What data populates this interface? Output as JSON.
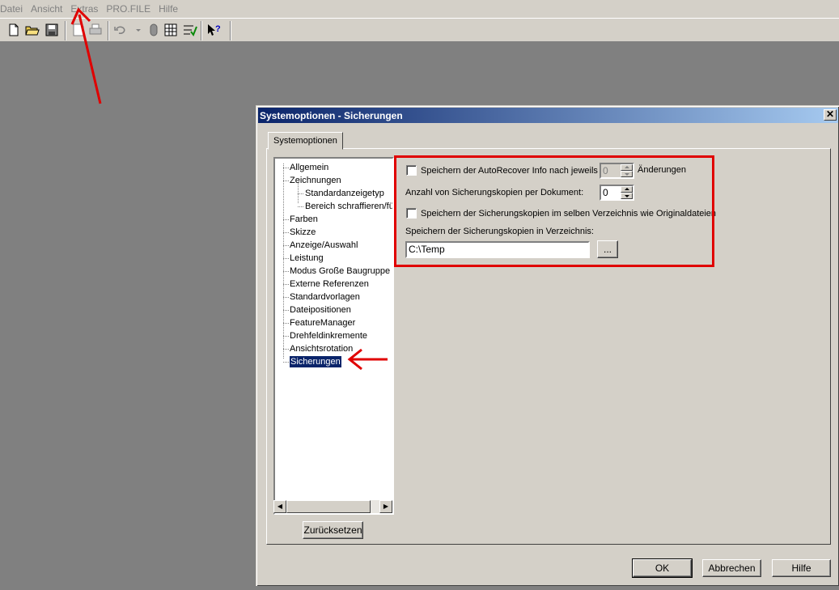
{
  "menu": [
    "Datei",
    "Ansicht",
    "Extras",
    "PRO.FILE",
    "Hilfe"
  ],
  "toolbar_icons": [
    "new-document-icon",
    "open-folder-icon",
    "save-icon",
    "print-preview-icon",
    "print-icon",
    "undo-icon",
    "dropdown-arrow-icon",
    "rebuild-icon",
    "grid-icon",
    "options-icon",
    "help-icon"
  ],
  "dialog": {
    "title": "Systemoptionen - Sicherungen",
    "close_label": "✕",
    "tab_label": "Systemoptionen",
    "tree": {
      "items": [
        {
          "label": "Allgemein",
          "level": 0
        },
        {
          "label": "Zeichnungen",
          "level": 0
        },
        {
          "label": "Standardanzeigetyp",
          "level": 1
        },
        {
          "label": "Bereich schraffieren/füllen",
          "level": 1
        },
        {
          "label": "Farben",
          "level": 0
        },
        {
          "label": "Skizze",
          "level": 0
        },
        {
          "label": "Anzeige/Auswahl",
          "level": 0
        },
        {
          "label": "Leistung",
          "level": 0
        },
        {
          "label": "Modus Große Baugruppe",
          "level": 0
        },
        {
          "label": "Externe Referenzen",
          "level": 0
        },
        {
          "label": "Standardvorlagen",
          "level": 0
        },
        {
          "label": "Dateipositionen",
          "level": 0
        },
        {
          "label": "FeatureManager",
          "level": 0
        },
        {
          "label": "Drehfeldinkremente",
          "level": 0
        },
        {
          "label": "Ansichtsrotation",
          "level": 0
        },
        {
          "label": "Sicherungen",
          "level": 0,
          "selected": true
        }
      ]
    },
    "reset_label": "Zurücksetzen",
    "options": {
      "autorecover_label": "Speichern der AutoRecover Info nach jeweils",
      "autorecover_value": "0",
      "autorecover_suffix": "Änderungen",
      "backup_count_label": "Anzahl von Sicherungskopien per Dokument:",
      "backup_count_value": "0",
      "same_dir_label": "Speichern der Sicherungskopien im selben Verzeichnis wie Originaldateien",
      "dir_label": "Speichern der Sicherungskopien in Verzeichnis:",
      "dir_value": "C:\\Temp",
      "browse_label": "..."
    },
    "ok_label": "OK",
    "cancel_label": "Abbrechen",
    "help_label": "Hilfe"
  },
  "colors": {
    "annotation": "#e00000",
    "selection": "#0a246a",
    "titlebar_start": "#0a246a",
    "titlebar_end": "#a6caf0"
  }
}
